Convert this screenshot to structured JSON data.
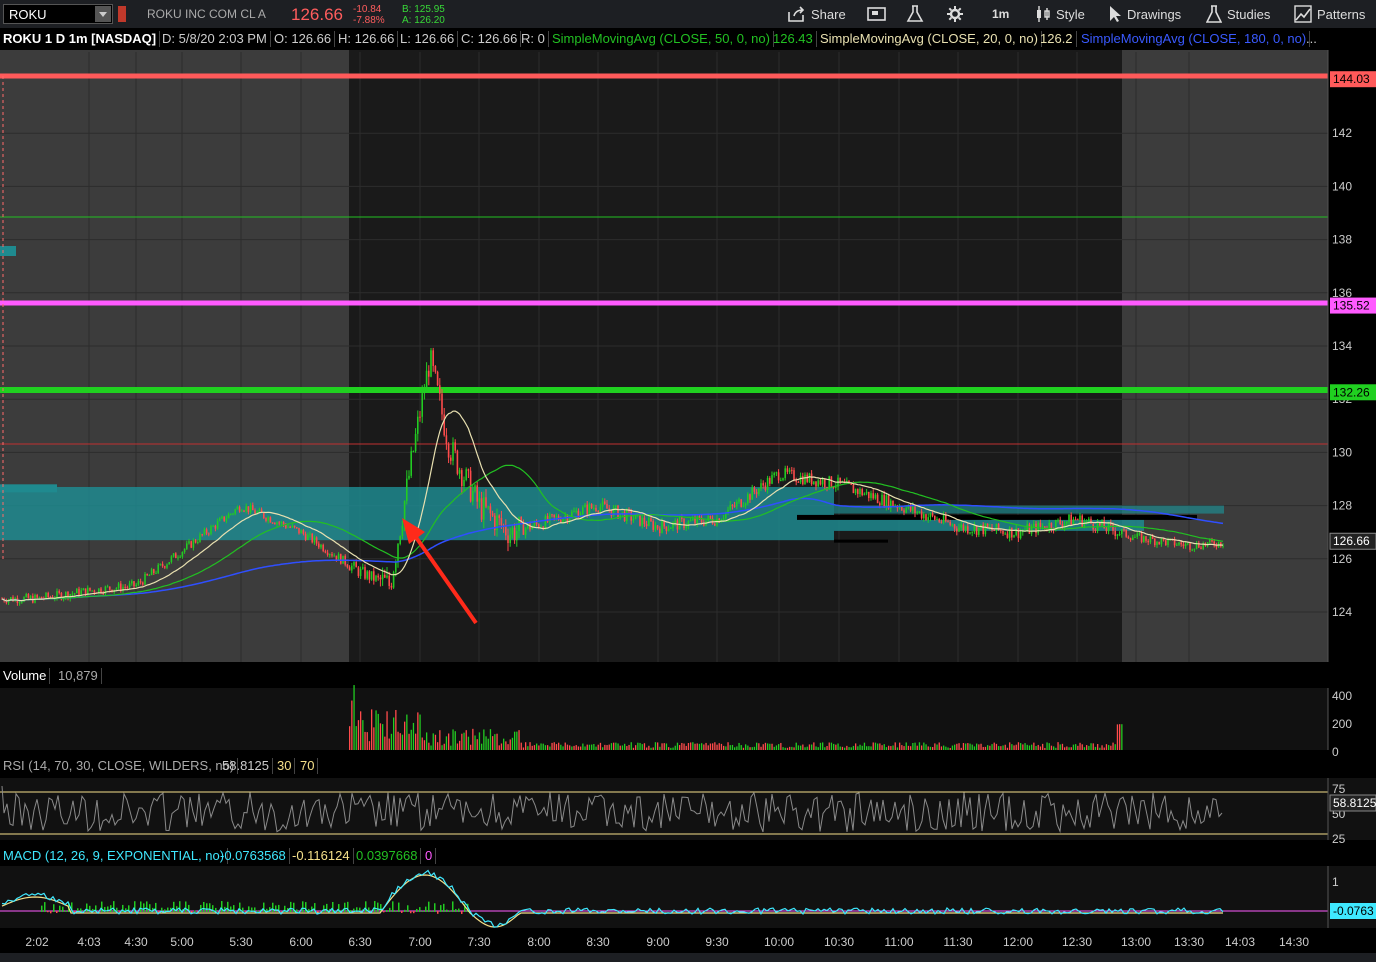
{
  "toolbar": {
    "symbol": "ROKU",
    "company": "ROKU INC COM CL A",
    "last_price": "126.66",
    "net_change": "-10.84",
    "pct_change": "-7.88%",
    "bid": "B: 125.95",
    "ask": "A: 126.20",
    "share_label": "Share",
    "timeframe_label": "1m",
    "style_label": "Style",
    "drawings_label": "Drawings",
    "studies_label": "Studies",
    "patterns_label": "Patterns",
    "icons": [
      "share-icon",
      "flag-icon",
      "flask-icon",
      "gear-icon",
      "candle-style-icon",
      "cursor-icon",
      "studies-flask-icon",
      "patterns-icon"
    ]
  },
  "header": {
    "title": "ROKU 1 D 1m [NASDAQ]",
    "date": "D: 5/8/20 2:03 PM",
    "open": "O: 126.66",
    "high": "H: 126.66",
    "low": "L: 126.66",
    "close": "C: 126.66",
    "range": "R: 0",
    "sma50_label": "SimpleMovingAvg (CLOSE, 50, 0, no)",
    "sma50_value": "126.43",
    "sma20_label": "SimpleMovingAvg (CLOSE, 20, 0, no)",
    "sma20_value": "126.2",
    "sma180_label": "SimpleMovingAvg (CLOSE, 180, 0, no)",
    "more": "..."
  },
  "price_levels": [
    {
      "value": "144.03",
      "color": "#ff5a5a"
    },
    {
      "value": "135.52",
      "color": "#ff5aff"
    },
    {
      "value": "132.26",
      "color": "#20d020"
    },
    {
      "value": "126.66",
      "color": "#ffffff"
    }
  ],
  "price_axis_ticks": [
    "142",
    "140",
    "138",
    "136",
    "134",
    "132",
    "130",
    "128",
    "126",
    "124"
  ],
  "time_axis_ticks": [
    "2:02",
    "4:03",
    "4:30",
    "5:00",
    "5:30",
    "6:00",
    "6:30",
    "7:00",
    "7:30",
    "8:00",
    "8:30",
    "9:00",
    "9:30",
    "10:00",
    "10:30",
    "11:00",
    "11:30",
    "12:00",
    "12:30",
    "13:00",
    "13:30",
    "14:03",
    "14:30"
  ],
  "volume": {
    "label": "Volume",
    "value": "10,879",
    "ticks": [
      "400",
      "200",
      "0"
    ]
  },
  "rsi": {
    "label": "RSI (14, 70, 30, CLOSE, WILDERS, no)",
    "value": "58.8125",
    "over_sold": "30",
    "over_bought": "70",
    "ticks": [
      "75",
      "50",
      "25"
    ],
    "last_badge": "58.8125"
  },
  "macd": {
    "label": "MACD (12, 26, 9, EXPONENTIAL, no)",
    "value": "-0.0763568",
    "avg": "-0.116124",
    "diff": "0.0397668",
    "zero": "0",
    "ticks": [
      "1"
    ],
    "last_badge": "-0.0763"
  },
  "colors": {
    "background": "#000000",
    "premarket_shade": "#3c3c3c",
    "session_bg": "#1a1a1a",
    "value_area": "#1f8a8f",
    "sma20": "#e8e0b0",
    "sma50": "#22c022",
    "sma180": "#2f4fff",
    "candle_up": "#22cc22",
    "candle_down": "#ff4b4b",
    "arrow": "#ff2a1a"
  },
  "chart_data": {
    "type": "candlestick",
    "title": "ROKU 1 D 1m [NASDAQ]",
    "x_axis": "time",
    "y_axis": "price",
    "ylim": [
      123,
      145
    ],
    "horizontal_levels": [
      144.03,
      138.85,
      135.52,
      132.26,
      130.3
    ],
    "last": 126.66,
    "keypoints": [
      {
        "t": "2:02",
        "price": 124.5
      },
      {
        "t": "4:03",
        "price": 124.8
      },
      {
        "t": "4:30",
        "price": 125.0
      },
      {
        "t": "5:00",
        "price": 126.3
      },
      {
        "t": "5:30",
        "price": 128.0
      },
      {
        "t": "6:00",
        "price": 127.0
      },
      {
        "t": "6:30",
        "price": 125.5
      },
      {
        "t": "6:45",
        "price": 125.0
      },
      {
        "t": "7:00",
        "price": 131.5
      },
      {
        "t": "7:05",
        "price": 133.5
      },
      {
        "t": "7:15",
        "price": 130.2
      },
      {
        "t": "7:30",
        "price": 128.0
      },
      {
        "t": "7:45",
        "price": 127.0
      },
      {
        "t": "8:00",
        "price": 127.3
      },
      {
        "t": "8:30",
        "price": 128.0
      },
      {
        "t": "9:00",
        "price": 127.2
      },
      {
        "t": "9:30",
        "price": 127.5
      },
      {
        "t": "10:00",
        "price": 129.2
      },
      {
        "t": "10:30",
        "price": 128.8
      },
      {
        "t": "11:00",
        "price": 128.0
      },
      {
        "t": "11:30",
        "price": 127.2
      },
      {
        "t": "12:00",
        "price": 127.0
      },
      {
        "t": "12:30",
        "price": 127.5
      },
      {
        "t": "13:00",
        "price": 126.8
      },
      {
        "t": "13:30",
        "price": 126.5
      },
      {
        "t": "14:03",
        "price": 126.66
      }
    ],
    "series": [
      {
        "name": "SimpleMovingAvg (CLOSE, 20, 0, no)",
        "last": 126.2
      },
      {
        "name": "SimpleMovingAvg (CLOSE, 50, 0, no)",
        "last": 126.43
      },
      {
        "name": "SimpleMovingAvg (CLOSE, 180, 0, no)"
      }
    ]
  }
}
